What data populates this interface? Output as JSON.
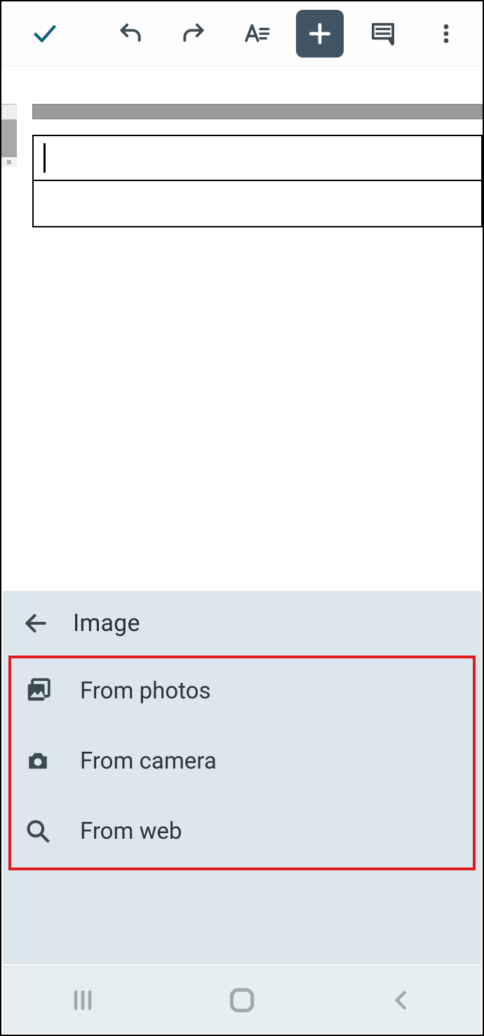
{
  "toolbar": {
    "done_icon": "check",
    "undo_icon": "undo",
    "redo_icon": "redo",
    "format_icon": "text-format",
    "insert_icon": "plus",
    "comment_icon": "comment",
    "overflow_icon": "more-vertical",
    "insert_active": true
  },
  "document": {
    "rows": [
      "",
      ""
    ],
    "active_row": 0
  },
  "insert_panel": {
    "header_title": "Image",
    "back_icon": "arrow-left",
    "items": [
      {
        "icon": "photo-library",
        "label": "From photos"
      },
      {
        "icon": "camera",
        "label": "From camera"
      },
      {
        "icon": "search",
        "label": "From web"
      }
    ],
    "highlight_box": true
  },
  "sysnav": {
    "recents_icon": "recents",
    "home_icon": "home",
    "back_icon": "back"
  },
  "colors": {
    "toolbar_active_bg": "#415463",
    "panel_bg": "#dbe7ec",
    "highlight": "#e11b1b",
    "teal": "#12657d",
    "icon_gray": "#3d4a53"
  }
}
